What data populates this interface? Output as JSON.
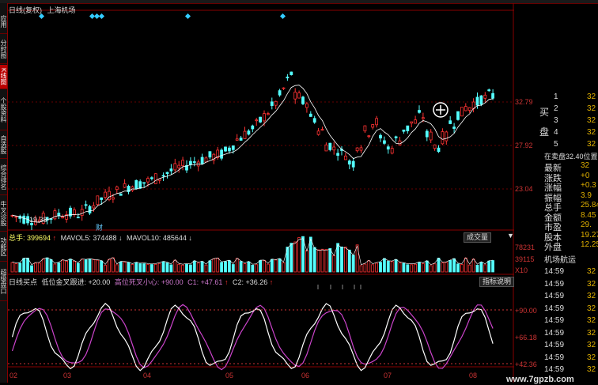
{
  "sidebar": {
    "tabs": [
      "应用",
      "分时图",
      "K线图",
      "个股资料",
      "自选股",
      "综合排名",
      "牛叉诊股",
      "功能区",
      "超级盘口"
    ],
    "active_index": 2
  },
  "chart": {
    "title": "日线(复权)",
    "stock_name": "上海机场",
    "price_ticks": [
      "32.79",
      "27.92",
      "23.04"
    ],
    "low_label": "19.38",
    "event_label": "财",
    "cursor_icon": "crosshair-icon"
  },
  "volume": {
    "legend_total": "总手: 399694",
    "legend_mavol5": "MAVOL5: 374488",
    "legend_mavol10": "MAVOL10: 485644",
    "button": "成交量",
    "ticks": [
      "78231",
      "39115",
      "X10"
    ]
  },
  "indicator": {
    "name": "日线买点",
    "line1": "低位金叉跟进: +20.00",
    "line2": "高位死叉小心: +90.00",
    "c1": "C1: +47.61",
    "c2": "C2: +36.26",
    "button": "指标说明",
    "ticks": [
      "+90.00",
      "+66.18",
      "+42.36"
    ]
  },
  "xaxis": {
    "ticks": [
      "02",
      "03",
      "04",
      "05",
      "06",
      "07",
      "08"
    ]
  },
  "right_panel": {
    "buy_label": "买",
    "sell_label": "盘",
    "levels": [
      {
        "n": "1",
        "v": "32"
      },
      {
        "n": "2",
        "v": "32"
      },
      {
        "n": "3",
        "v": "32"
      },
      {
        "n": "4",
        "v": "32"
      },
      {
        "n": "5",
        "v": "32"
      }
    ],
    "notice": "在卖盘32.40位置有",
    "stats": [
      {
        "k": "最新",
        "v": "32"
      },
      {
        "k": "涨跌",
        "v": "+0"
      },
      {
        "k": "涨幅",
        "v": "+0.3"
      },
      {
        "k": "振幅",
        "v": "3.9"
      },
      {
        "k": "总手",
        "v": "25.84"
      },
      {
        "k": "金额",
        "v": "8.45"
      },
      {
        "k": "市盈",
        "v": "29."
      },
      {
        "k": "股本",
        "v": "19.27"
      },
      {
        "k": "外盘",
        "v": "12.25"
      }
    ],
    "ticker_title": "机场航运",
    "trades": [
      {
        "t": "14:59",
        "v": "32"
      },
      {
        "t": "14:59",
        "v": "32"
      },
      {
        "t": "14:59",
        "v": "32"
      },
      {
        "t": "14:59",
        "v": "32"
      },
      {
        "t": "14:59",
        "v": "32"
      },
      {
        "t": "14:59",
        "v": "32"
      },
      {
        "t": "14:59",
        "v": "32"
      },
      {
        "t": "14:59",
        "v": "32"
      },
      {
        "t": "14:59",
        "v": "32"
      }
    ]
  },
  "watermark": "www.7gpzb.com",
  "colors": {
    "up": "#ff3333",
    "down": "#54ffff",
    "ma": "#ffffff",
    "k": "#ffffff",
    "d": "#cc44cc"
  }
}
